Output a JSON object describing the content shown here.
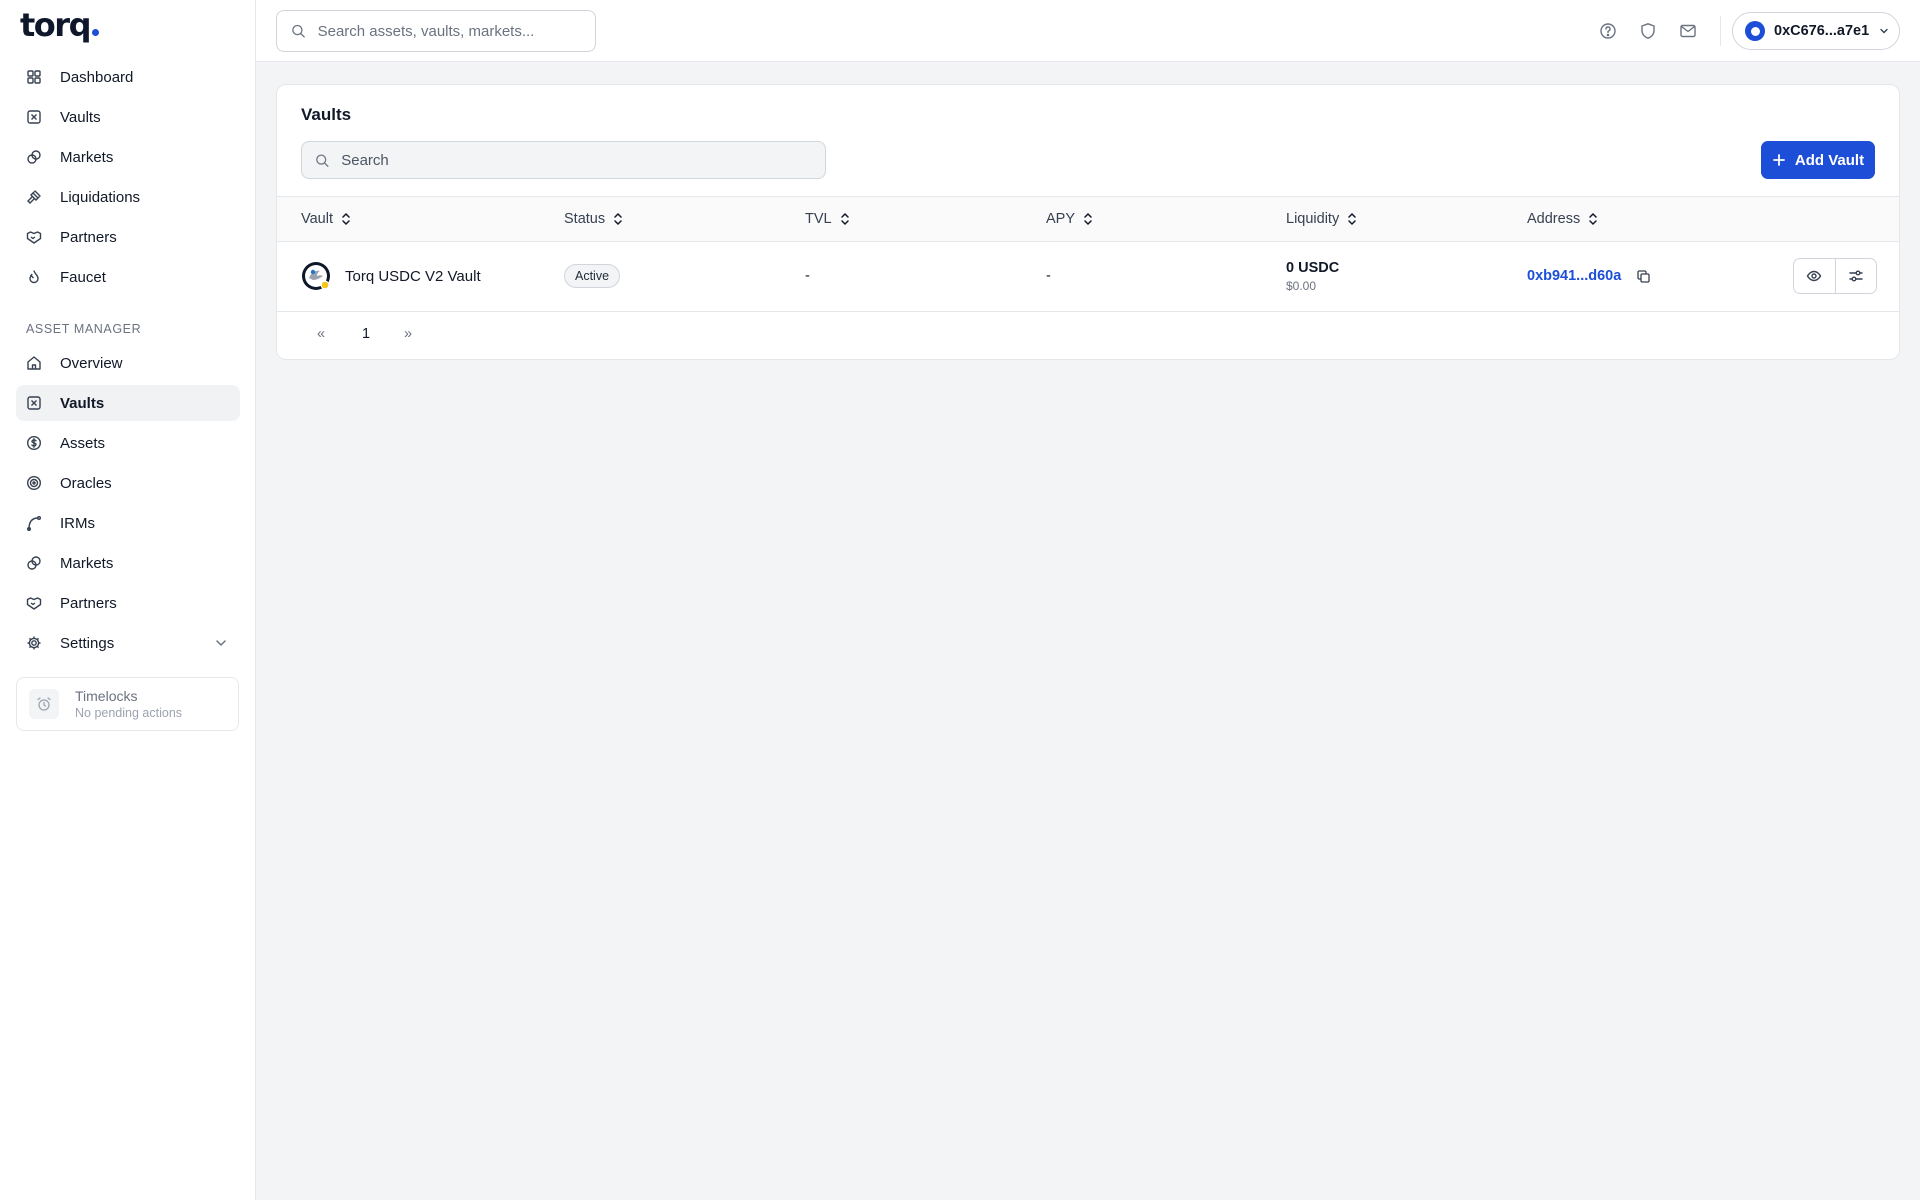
{
  "brand": {
    "name": "torq",
    "accent": "#1d4ed8"
  },
  "sidebar": {
    "main_items": [
      {
        "label": "Dashboard",
        "icon": "dashboard-grid-icon"
      },
      {
        "label": "Vaults",
        "icon": "vault-icon"
      },
      {
        "label": "Markets",
        "icon": "markets-icon"
      },
      {
        "label": "Liquidations",
        "icon": "gavel-icon"
      },
      {
        "label": "Partners",
        "icon": "handshake-icon"
      },
      {
        "label": "Faucet",
        "icon": "droplet-icon"
      }
    ],
    "section_label": "ASSET MANAGER",
    "manager_items": [
      {
        "label": "Overview",
        "icon": "home-icon"
      },
      {
        "label": "Vaults",
        "icon": "vault-icon",
        "active": true
      },
      {
        "label": "Assets",
        "icon": "dollar-circle-icon"
      },
      {
        "label": "Oracles",
        "icon": "target-icon"
      },
      {
        "label": "IRMs",
        "icon": "curve-icon"
      },
      {
        "label": "Markets",
        "icon": "markets-icon"
      },
      {
        "label": "Partners",
        "icon": "handshake-icon"
      },
      {
        "label": "Settings",
        "icon": "gear-icon"
      }
    ],
    "timelocks": {
      "title": "Timelocks",
      "subtitle": "No pending actions"
    }
  },
  "header": {
    "search_placeholder": "Search assets, vaults, markets...",
    "wallet_address": "0xC676...a7e1"
  },
  "page": {
    "title": "Vaults",
    "search_placeholder": "Search",
    "add_button": "Add Vault",
    "columns": [
      "Vault",
      "Status",
      "TVL",
      "APY",
      "Liquidity",
      "Address"
    ],
    "rows": [
      {
        "vault": "Torq USDC V2 Vault",
        "status": "Active",
        "tvl": "-",
        "apy": "-",
        "liquidity": "0 USDC",
        "liquidity_usd": "$0.00",
        "address": "0xb941...d60a"
      }
    ],
    "pagination": {
      "prev": "«",
      "current": "1",
      "next": "»"
    }
  }
}
